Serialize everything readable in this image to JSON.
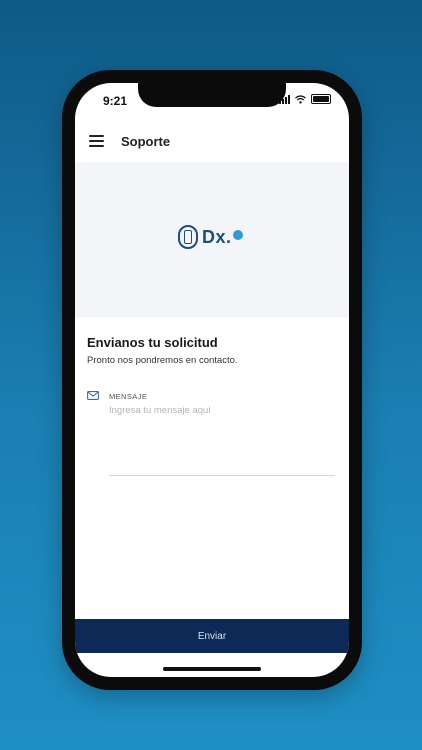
{
  "status_bar": {
    "time": "9:21"
  },
  "app_bar": {
    "title": "Soporte",
    "menu_icon": "hamburger-icon"
  },
  "logo": {
    "text": "Dx."
  },
  "form": {
    "heading": "Envianos tu solicitud",
    "subtitle": "Pronto nos pondremos en contacto.",
    "message_label": "MENSAJE",
    "message_placeholder": "Ingresa tu mensaje aquí",
    "message_value": ""
  },
  "actions": {
    "send_label": "Enviar"
  },
  "colors": {
    "background": "#1b7fb3",
    "send_button": "#0c2a55",
    "brand": "#1c4f7c",
    "accent": "#2f9bd6"
  }
}
